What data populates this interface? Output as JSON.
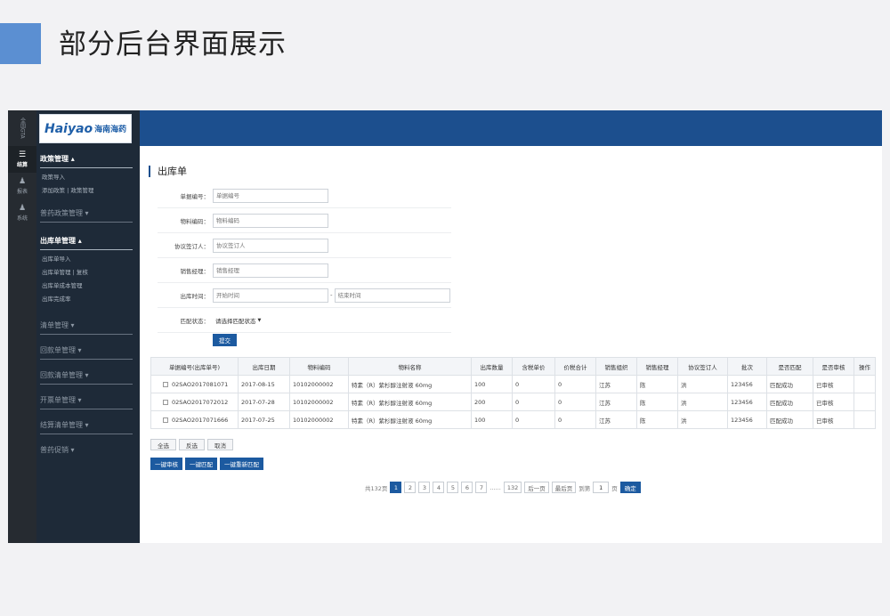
{
  "slide": {
    "title": "部分后台界面展示"
  },
  "rail": {
    "top_label": "全国GTA",
    "items": [
      {
        "label": "结算",
        "icon": "list-icon",
        "glyph": "☰"
      },
      {
        "label": "报表",
        "icon": "users-icon",
        "glyph": "♟"
      },
      {
        "label": "系统",
        "icon": "settings-users-icon",
        "glyph": "♟"
      }
    ]
  },
  "logo": {
    "en": "Haiyao",
    "cn": "海南海药"
  },
  "menu": {
    "section1": {
      "head": "政策管理",
      "subs": [
        "政策导入",
        "添加政策 | 政策管理"
      ]
    },
    "section2": {
      "head": "普药政策管理"
    },
    "section3": {
      "head": "出库单管理",
      "subs": [
        "出库单导入",
        "出库单管理 | 复核",
        "出库单成本管理",
        "出库完成率"
      ]
    },
    "others": [
      "清单管理",
      "回款单管理",
      "回款清单管理",
      "开票单管理",
      "结算清单管理",
      "普药促销"
    ]
  },
  "panel": {
    "title": "出库单"
  },
  "form": {
    "order_no": {
      "label": "单据编号：",
      "placeholder": "单据编号"
    },
    "material_code": {
      "label": "物料编码：",
      "placeholder": "物料编码"
    },
    "signer": {
      "label": "协议签订人：",
      "placeholder": "协议签订人"
    },
    "manager": {
      "label": "销售经理：",
      "placeholder": "销售经理"
    },
    "out_time": {
      "label": "出库时间：",
      "start_placeholder": "开始时间",
      "sep": "-",
      "end_placeholder": "结束时间"
    },
    "match_status": {
      "label": "匹配状态：",
      "value": "请选择匹配状态"
    },
    "submit": "提交"
  },
  "table": {
    "headers": [
      "单据编号(出库单号)",
      "出库日期",
      "物料编码",
      "物料名称",
      "出库数量",
      "含税单价",
      "价税合计",
      "销售组织",
      "销售经理",
      "协议签订人",
      "批次",
      "是否匹配",
      "是否审核",
      "操作"
    ],
    "rows": [
      [
        "02SAO2017081071",
        "2017-08-15",
        "10102000002",
        "特素（R）紫杉醇注射液 60mg",
        "100",
        "0",
        "0",
        "江苏",
        "陈",
        "洪",
        "123456",
        "匹配成功",
        "已审核",
        ""
      ],
      [
        "02SAO2017072012",
        "2017-07-28",
        "10102000002",
        "特素（R）紫杉醇注射液 60mg",
        "200",
        "0",
        "0",
        "江苏",
        "陈",
        "洪",
        "123456",
        "匹配成功",
        "已审核",
        ""
      ],
      [
        "02SAO2017071666",
        "2017-07-25",
        "10102000002",
        "特素（R）紫杉醇注射液 60mg",
        "100",
        "0",
        "0",
        "江苏",
        "陈",
        "洪",
        "123456",
        "匹配成功",
        "已审核",
        ""
      ]
    ]
  },
  "actions": {
    "select_all": "全选",
    "invert": "反选",
    "cancel": "取消",
    "audit_all": "一键审核",
    "match_all": "一键匹配",
    "rematch_all": "一键重新匹配"
  },
  "pager": {
    "total": "共132页",
    "pages": [
      "1",
      "2",
      "3",
      "4",
      "5",
      "6",
      "7"
    ],
    "ellipsis": "......",
    "last_page": "132",
    "next": "后一页",
    "last": "最后页",
    "goto_label": "到第",
    "goto_value": "1",
    "page_unit": "页",
    "confirm": "确定"
  },
  "colors": {
    "topbar": "#1c4f8e",
    "sidebar": "#1e2a38",
    "rail": "#262b31",
    "accent": "#5b8fd2",
    "primary_button": "#1c5aa0"
  }
}
